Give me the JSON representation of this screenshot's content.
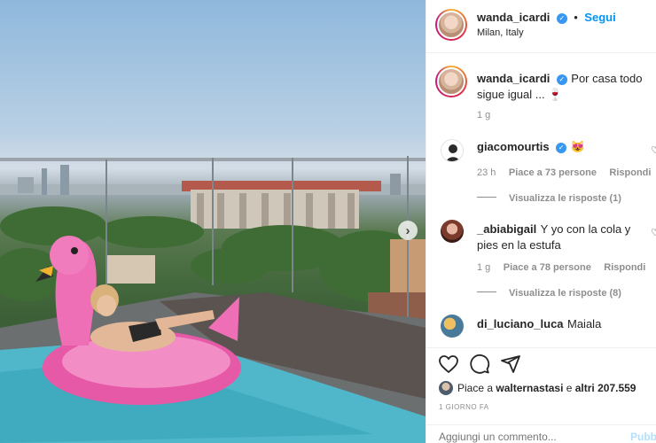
{
  "post": {
    "username": "wanda_icardi",
    "follow_label": "Segui",
    "location": "Milan, Italy",
    "caption": "Por casa todo sigue igual ... 🍷",
    "caption_time": "1 g"
  },
  "comments": [
    {
      "username": "giacomourtis",
      "verified": true,
      "text": "😻",
      "time": "23 h",
      "likes": "Piace a 73 persone",
      "reply_label": "Rispondi",
      "replies_label": "Visualizza le risposte (1)"
    },
    {
      "username": "_abiabigail",
      "verified": false,
      "text": "Y yo con la cola y pies en la estufa",
      "time": "1 g",
      "likes": "Piace a 78 persone",
      "reply_label": "Rispondi",
      "replies_label": "Visualizza le risposte (8)"
    },
    {
      "username": "di_luciano_luca",
      "verified": false,
      "text": "Maiala"
    }
  ],
  "footer": {
    "likes_prefix": "Piace a ",
    "likes_user": "walternastasi",
    "likes_middle": " e ",
    "likes_others": "altri 207.559",
    "time_ago": "1 GIORNO FA",
    "comment_placeholder": "Aggiungi un commento...",
    "publish_label": "Pubblica"
  },
  "colors": {
    "accent": "#0095f6",
    "verified": "#3897f0",
    "text": "#262626",
    "muted": "#8e8e8e",
    "flamingo": "#ee6fb6"
  },
  "icons": [
    "verified-icon",
    "heart-icon",
    "comment-icon",
    "share-icon",
    "chevron-right-icon"
  ]
}
